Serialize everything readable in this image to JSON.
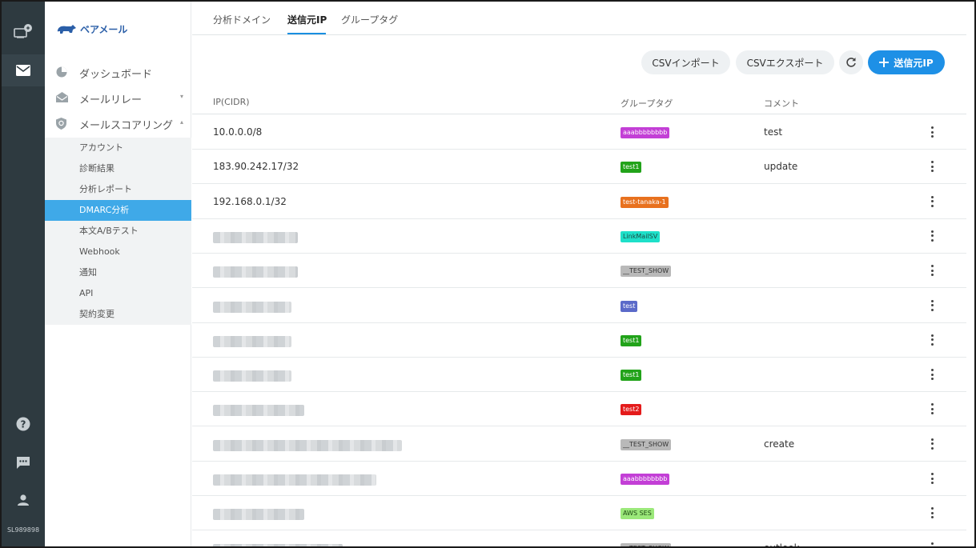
{
  "rail": {
    "user_id": "SL989898",
    "icons": [
      "display-icon",
      "mail-icon",
      "help-icon",
      "chat-icon",
      "person-icon"
    ]
  },
  "brand": {
    "name": "ベアメール",
    "logo_icon": "bear-icon",
    "color": "#2b5fa8"
  },
  "sidebar": {
    "main_items": [
      {
        "label": "ダッシュボード",
        "icon": "pie-chart-icon"
      },
      {
        "label": "メールリレー",
        "icon": "inbox-icon",
        "caret": "▾"
      },
      {
        "label": "メールスコアリング",
        "icon": "shield-icon",
        "caret": "▴"
      }
    ],
    "sub_items": [
      {
        "label": "アカウント"
      },
      {
        "label": "診断結果"
      },
      {
        "label": "分析レポート"
      },
      {
        "label": "DMARC分析",
        "active": true
      },
      {
        "label": "本文A/Bテスト"
      },
      {
        "label": "Webhook"
      },
      {
        "label": "通知"
      },
      {
        "label": "API"
      },
      {
        "label": "契約変更"
      }
    ]
  },
  "tabs": [
    {
      "label": "分析ドメイン",
      "active": false
    },
    {
      "label": "送信元IP",
      "active": true
    },
    {
      "label": "グループタグ",
      "active": false
    }
  ],
  "toolbar": {
    "csv_import": "CSVインポート",
    "csv_export": "CSVエクスポート",
    "refresh_icon": "refresh-icon",
    "add_label": "送信元IP",
    "add_icon": "plus-icon",
    "accent": "#1e90e6"
  },
  "table": {
    "headers": {
      "ip": "IP(CIDR)",
      "group": "グループタグ",
      "comment": "コメント"
    },
    "rows": [
      {
        "ip": "10.0.0.0/8",
        "tag": "aaabbbbbbbb",
        "tag_color": "#c33fd6",
        "comment": "test"
      },
      {
        "ip": "183.90.242.17/32",
        "tag": "test1",
        "tag_color": "#22a31a",
        "comment": "update"
      },
      {
        "ip": "192.168.0.1/32",
        "tag": "test-tanaka-1",
        "tag_color": "#e8711e",
        "comment": ""
      },
      {
        "ip": "",
        "masked": true,
        "tag": "LinkMailSV",
        "tag_color": "#1ee0c9",
        "tag_text_color": "#1d4b45",
        "comment": ""
      },
      {
        "ip": "",
        "masked": true,
        "tag": "__TEST_SHOW",
        "tag_color": "#b9b9b9",
        "tag_text_color": "#333333",
        "comment": ""
      },
      {
        "ip": "",
        "masked": true,
        "tag": "test",
        "tag_color": "#5b6ac9",
        "comment": ""
      },
      {
        "ip": "",
        "masked": true,
        "tag": "test1",
        "tag_color": "#22a31a",
        "comment": ""
      },
      {
        "ip": "",
        "masked": true,
        "tag": "test1",
        "tag_color": "#22a31a",
        "comment": ""
      },
      {
        "ip": "",
        "masked": true,
        "tag": "test2",
        "tag_color": "#e41b1b",
        "comment": ""
      },
      {
        "ip": "",
        "masked": true,
        "tag": "__TEST_SHOW",
        "tag_color": "#b9b9b9",
        "tag_text_color": "#333333",
        "comment": "create"
      },
      {
        "ip": "",
        "masked": true,
        "tag": "aaabbbbbbbb",
        "tag_color": "#c33fd6",
        "comment": ""
      },
      {
        "ip": "",
        "masked": true,
        "tag": "AWS SES",
        "tag_color": "#9be87a",
        "tag_text_color": "#1f4a14",
        "comment": ""
      },
      {
        "ip": "",
        "masked": true,
        "tag": "__TEST_SHOW",
        "tag_color": "#b9b9b9",
        "tag_text_color": "#333333",
        "comment": "outlook"
      }
    ]
  }
}
